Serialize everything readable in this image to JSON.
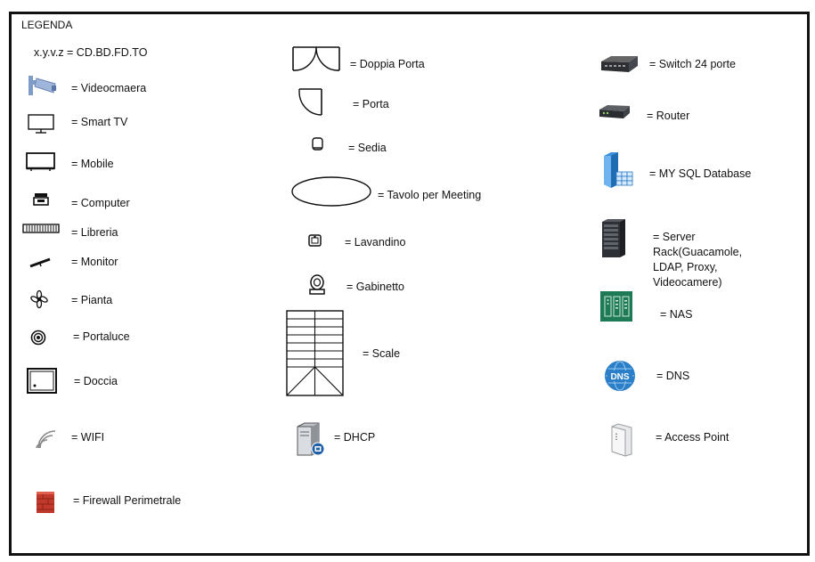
{
  "legend": {
    "title": "LEGENDA",
    "note": "x.y.v.z = CD.BD.FD.TO",
    "column1": [
      {
        "icon": "security-camera-icon",
        "label": "= Videocmaera"
      },
      {
        "icon": "smart-tv-icon",
        "label": "= Smart TV"
      },
      {
        "icon": "cabinet-icon",
        "label": "= Mobile"
      },
      {
        "icon": "computer-icon",
        "label": "= Computer"
      },
      {
        "icon": "bookshelf-icon",
        "label": "= Libreria"
      },
      {
        "icon": "monitor-icon",
        "label": "= Monitor"
      },
      {
        "icon": "plant-icon",
        "label": "= Pianta"
      },
      {
        "icon": "lamp-icon",
        "label": "= Portaluce"
      },
      {
        "icon": "shower-icon",
        "label": "= Doccia"
      },
      {
        "icon": "wifi-icon",
        "label": "= WIFI"
      },
      {
        "icon": "firewall-icon",
        "label": "= Firewall Perimetrale"
      }
    ],
    "column2": [
      {
        "icon": "double-door-icon",
        "label": "= Doppia Porta"
      },
      {
        "icon": "door-icon",
        "label": "= Porta"
      },
      {
        "icon": "chair-icon",
        "label": "= Sedia"
      },
      {
        "icon": "meeting-table-icon",
        "label": "= Tavolo per Meeting"
      },
      {
        "icon": "sink-icon",
        "label": "= Lavandino"
      },
      {
        "icon": "toilet-icon",
        "label": "= Gabinetto"
      },
      {
        "icon": "stairs-icon",
        "label": "= Scale"
      },
      {
        "icon": "dhcp-server-icon",
        "label": "= DHCP"
      }
    ],
    "column3": [
      {
        "icon": "switch-icon",
        "label": "= Switch 24 porte"
      },
      {
        "icon": "router-icon",
        "label": "= Router"
      },
      {
        "icon": "database-icon",
        "label": "= MY SQL Database"
      },
      {
        "icon": "server-rack-icon",
        "label": "= Server Rack(Guacamole, LDAP, Proxy, Videocamere)"
      },
      {
        "icon": "nas-icon",
        "label": "= NAS"
      },
      {
        "icon": "dns-icon",
        "label": "= DNS"
      },
      {
        "icon": "access-point-icon",
        "label": "= Access Point"
      }
    ]
  },
  "colors": {
    "border": "#111111",
    "camera": "#7f9bc8",
    "nas": "#1e7a55",
    "dns": "#2a7fc8",
    "firewall": "#c0392b",
    "database": "#3a8fd8"
  }
}
